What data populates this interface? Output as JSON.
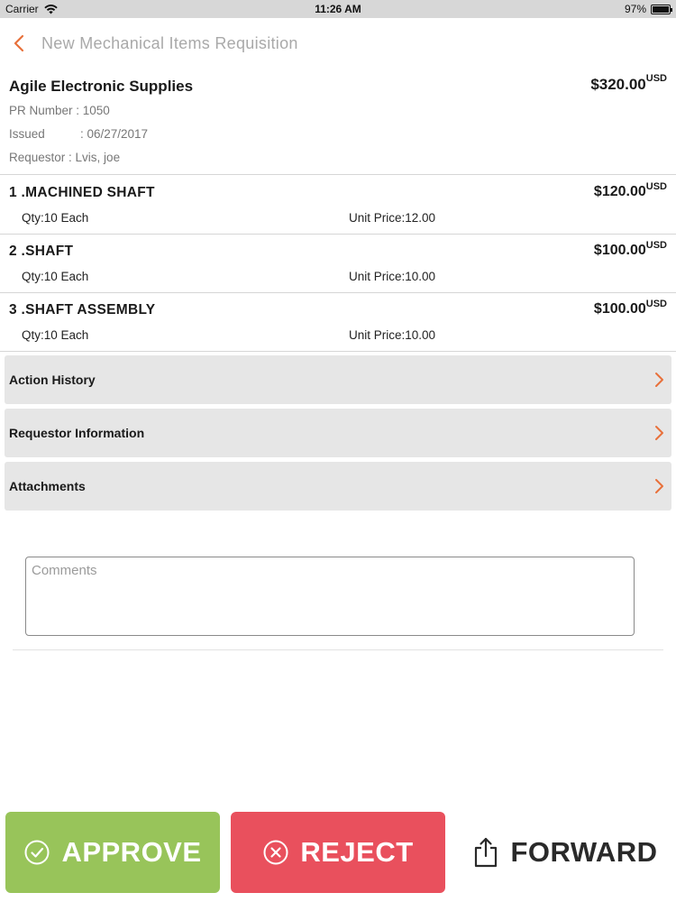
{
  "status_bar": {
    "carrier": "Carrier",
    "time": "11:26 AM",
    "battery": "97%"
  },
  "nav": {
    "title": "New Mechanical Items Requisition",
    "accent_color": "#e8703a"
  },
  "requisition": {
    "vendor": "Agile Electronic Supplies",
    "total": "$320.00",
    "currency": "USD",
    "pr_number_label": "PR Number",
    "pr_number_value": " : 1050",
    "issued_label": "Issued",
    "issued_value": ": 06/27/2017",
    "requestor_label": "Requestor",
    "requestor_value": " : Lvis, joe"
  },
  "items": [
    {
      "name": "1 .MACHINED SHAFT",
      "amount": "$120.00",
      "currency": "USD",
      "qty": "Qty:10 Each",
      "unit_price": "Unit Price:12.00"
    },
    {
      "name": "2 .SHAFT",
      "amount": "$100.00",
      "currency": "USD",
      "qty": "Qty:10 Each",
      "unit_price": "Unit Price:10.00"
    },
    {
      "name": "3 .SHAFT ASSEMBLY",
      "amount": "$100.00",
      "currency": "USD",
      "qty": "Qty:10 Each",
      "unit_price": "Unit Price:10.00"
    }
  ],
  "sections": [
    {
      "label": "Action History",
      "icon": "chevron-right-icon"
    },
    {
      "label": "Requestor Information",
      "icon": "chevron-right-icon"
    },
    {
      "label": "Attachments",
      "icon": "chevron-right-icon"
    }
  ],
  "comments": {
    "placeholder": "Comments"
  },
  "actions": {
    "approve_label": "APPROVE",
    "approve_color": "#98c45a",
    "reject_label": "REJECT",
    "reject_color": "#e9505d",
    "forward_label": "FORWARD"
  }
}
